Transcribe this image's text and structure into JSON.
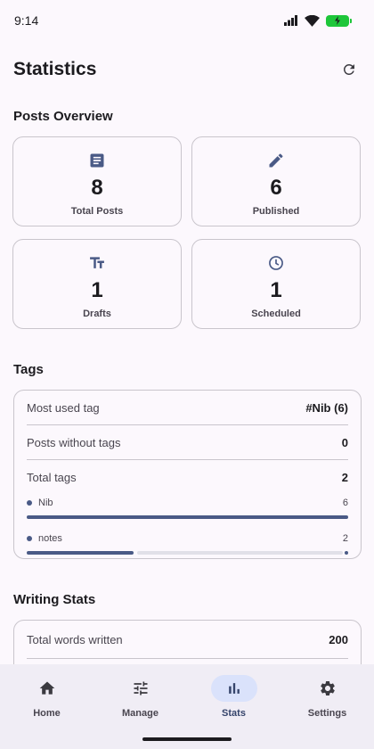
{
  "status": {
    "time": "9:14"
  },
  "header": {
    "title": "Statistics",
    "refresh_icon": "refresh-icon"
  },
  "posts_overview": {
    "title": "Posts Overview",
    "cards": [
      {
        "icon": "document-icon",
        "value": "8",
        "label": "Total Posts"
      },
      {
        "icon": "pencil-icon",
        "value": "6",
        "label": "Published"
      },
      {
        "icon": "text-format-icon",
        "value": "1",
        "label": "Drafts"
      },
      {
        "icon": "clock-icon",
        "value": "1",
        "label": "Scheduled"
      }
    ]
  },
  "tags": {
    "title": "Tags",
    "rows": [
      {
        "label": "Most used tag",
        "value": "#Nib (6)"
      },
      {
        "label": "Posts without tags",
        "value": "0"
      },
      {
        "label": "Total tags",
        "value": "2"
      }
    ],
    "bars": [
      {
        "name": "Nib",
        "count": "6",
        "fraction": 1.0
      },
      {
        "name": "notes",
        "count": "2",
        "fraction": 0.333
      }
    ]
  },
  "writing_stats": {
    "title": "Writing Stats",
    "rows": [
      {
        "label": "Total words written",
        "value": "200"
      }
    ]
  },
  "nav": {
    "items": [
      {
        "label": "Home",
        "icon": "home-icon"
      },
      {
        "label": "Manage",
        "icon": "sliders-icon"
      },
      {
        "label": "Stats",
        "icon": "bar-chart-icon",
        "active": true
      },
      {
        "label": "Settings",
        "icon": "gear-icon"
      }
    ]
  },
  "colors": {
    "accent": "#4a5a86",
    "battery": "#1ec63a",
    "nav_active_pill": "#dae2fb"
  }
}
